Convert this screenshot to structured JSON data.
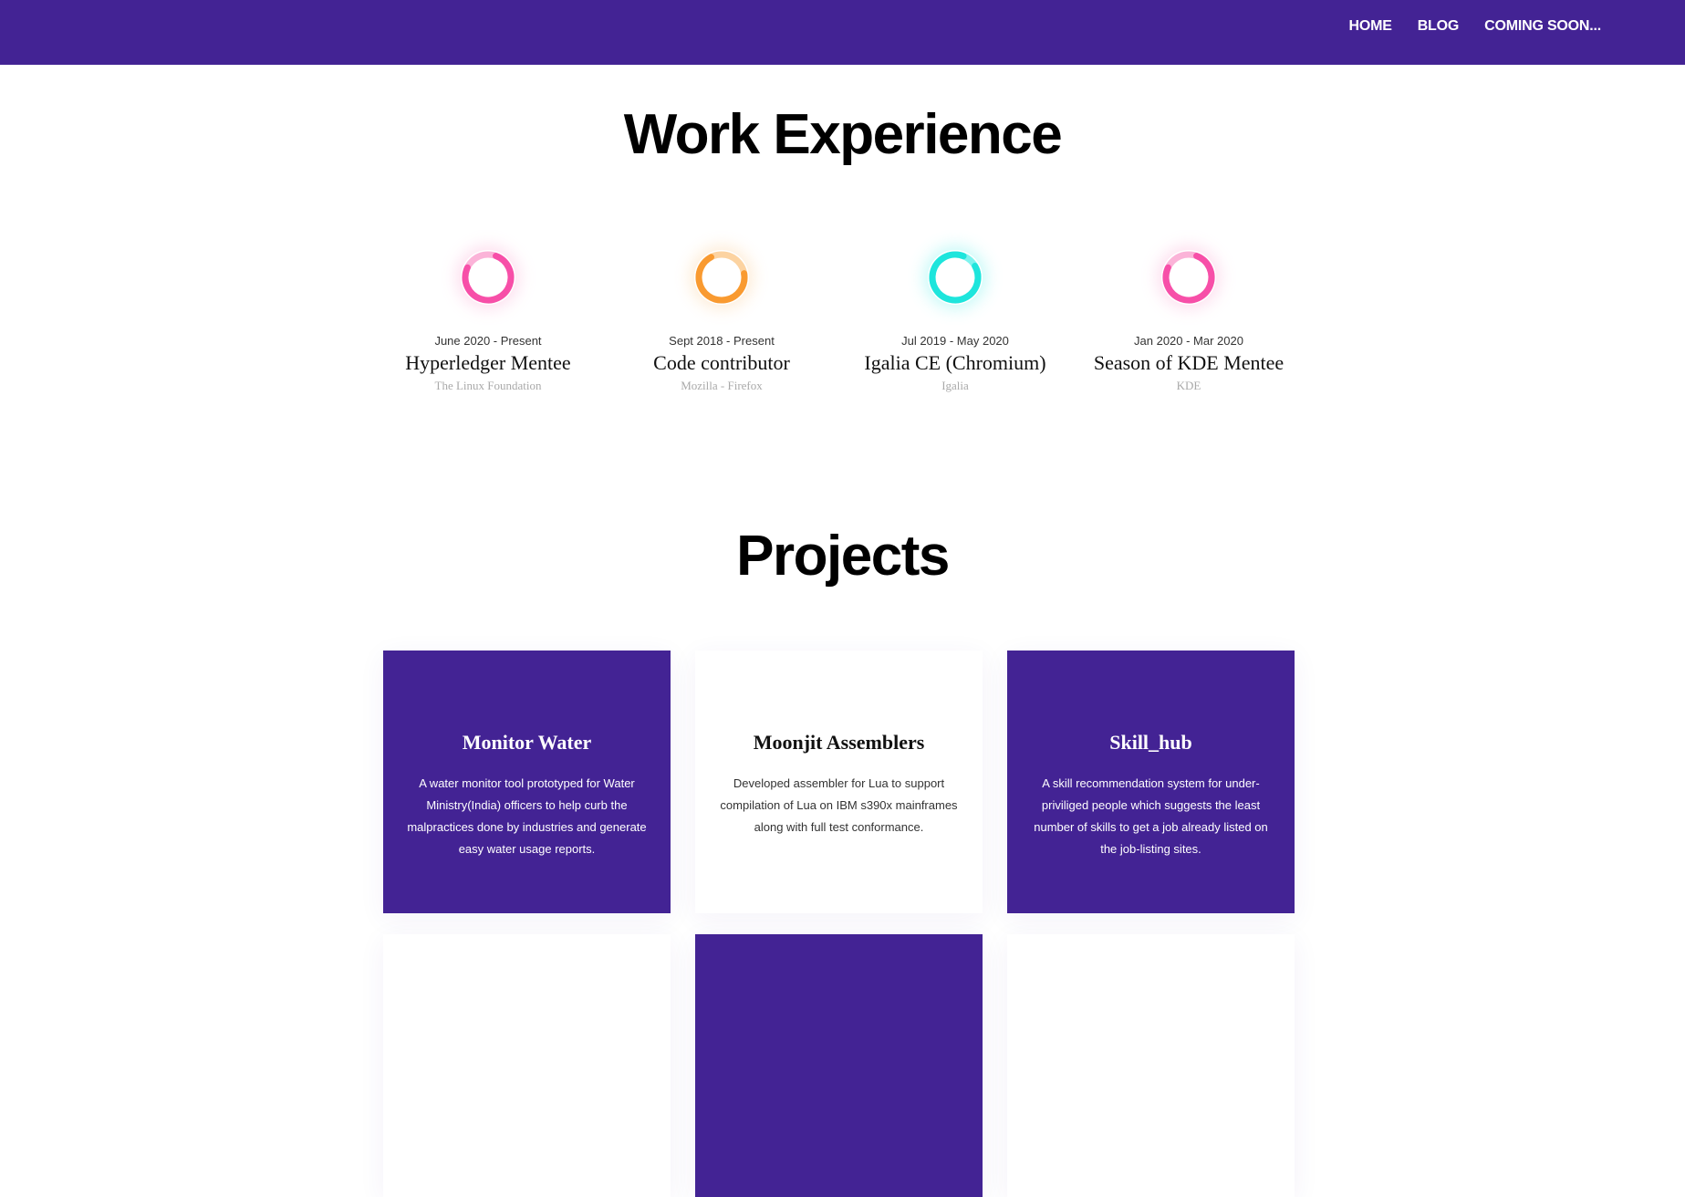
{
  "nav": {
    "links": [
      {
        "label": "HOME"
      },
      {
        "label": "BLOG"
      },
      {
        "label": "COMING SOON..."
      }
    ]
  },
  "work": {
    "title": "Work Experience",
    "items": [
      {
        "date": "June 2020 - Present",
        "role": "Hyperledger Mentee",
        "org": "The Linux Foundation",
        "ring_color": "#f74fa8",
        "ring_light": "#fbb3d8"
      },
      {
        "date": "Sept 2018 - Present",
        "role": "Code contributor",
        "org": "Mozilla - Firefox",
        "ring_color": "#f99a30",
        "ring_light": "#fcd3a1"
      },
      {
        "date": "Jul 2019 - May 2020",
        "role": "Igalia CE (Chromium)",
        "org": "Igalia",
        "ring_color": "#1ee5dc",
        "ring_light": "#7ef3ee"
      },
      {
        "date": "Jan 2020 - Mar 2020",
        "role": "Season of KDE Mentee",
        "org": "KDE",
        "ring_color": "#f74fa8",
        "ring_light": "#fbb3d8"
      }
    ]
  },
  "projects": {
    "title": "Projects",
    "items": [
      {
        "title": "Monitor Water",
        "desc": "A water monitor tool prototyped for Water Ministry(India) officers to help curb the malpractices done by industries and generate easy water usage reports.",
        "theme": "purple"
      },
      {
        "title": "Moonjit Assemblers",
        "desc": "Developed assembler for Lua to support compilation of Lua on IBM s390x mainframes along with full test conformance.",
        "theme": "white"
      },
      {
        "title": "Skill_hub",
        "desc": "A skill recommendation system for under-priviliged people which suggests the least number of skills to get a job already listed on the job-listing sites.",
        "theme": "purple"
      }
    ]
  },
  "colors": {
    "brand_purple": "#432394",
    "white": "#ffffff"
  }
}
